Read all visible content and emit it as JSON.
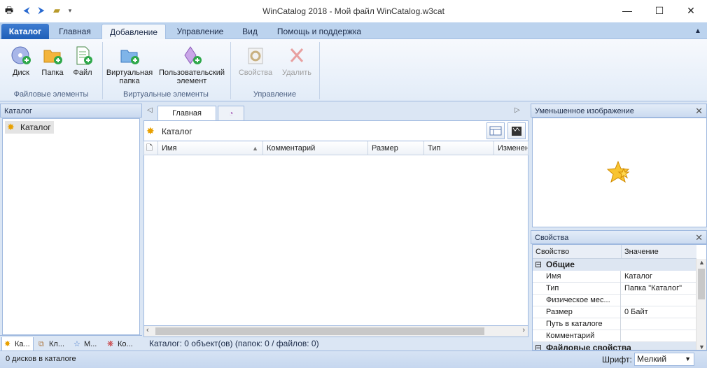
{
  "window": {
    "title": "WinCatalog 2018 - Мой файл WinCatalog.w3cat",
    "min_glyph": "—",
    "max_glyph": "☐",
    "close_glyph": "✕"
  },
  "ribbon_tabs": [
    "Каталог",
    "Главная",
    "Добавление",
    "Управление",
    "Вид",
    "Помощь и поддержка"
  ],
  "ribbon": {
    "file_group": {
      "label": "Файловые элементы",
      "disk": "Диск",
      "folder": "Папка",
      "file": "Файл"
    },
    "virtual_group": {
      "label": "Виртуальные элементы",
      "virtual_folder_1": "Виртуальная",
      "virtual_folder_2": "папка",
      "user_element_1": "Пользовательский",
      "user_element_2": "элемент"
    },
    "manage_group": {
      "label": "Управление",
      "properties": "Свойства",
      "delete": "Удалить"
    }
  },
  "left_panel": {
    "title": "Каталог",
    "tree_root": "Каталог",
    "bottom_tabs": [
      "Ка...",
      "Кл...",
      "М...",
      "Ко..."
    ]
  },
  "center": {
    "doc_tab": "Главная",
    "address": "Каталог",
    "columns": [
      "Имя",
      "Комментарий",
      "Размер",
      "Тип",
      "Изменен"
    ],
    "status": "Каталог: 0 объект(ов) (папок: 0 / файлов: 0)"
  },
  "thumbnail_panel": {
    "title": "Уменьшенное изображение"
  },
  "properties_panel": {
    "title": "Свойства",
    "header_key": "Свойство",
    "header_value": "Значение",
    "categories": [
      "Общие",
      "Файловые свойства"
    ],
    "rows": [
      {
        "key": "Имя",
        "value": "Каталог"
      },
      {
        "key": "Тип",
        "value": "Папка \"Каталог\""
      },
      {
        "key": "Физическое мес...",
        "value": ""
      },
      {
        "key": "Размер",
        "value": "0 Байт"
      },
      {
        "key": "Путь в каталоге",
        "value": ""
      },
      {
        "key": "Комментарий",
        "value": ""
      }
    ]
  },
  "status_bar": {
    "left": "0 дисков в каталоге",
    "font_label": "Шрифт:",
    "font_value": "Мелкий"
  },
  "colors": {
    "accent": "#1f5fb8",
    "panel_bg": "#dbe6f4"
  }
}
